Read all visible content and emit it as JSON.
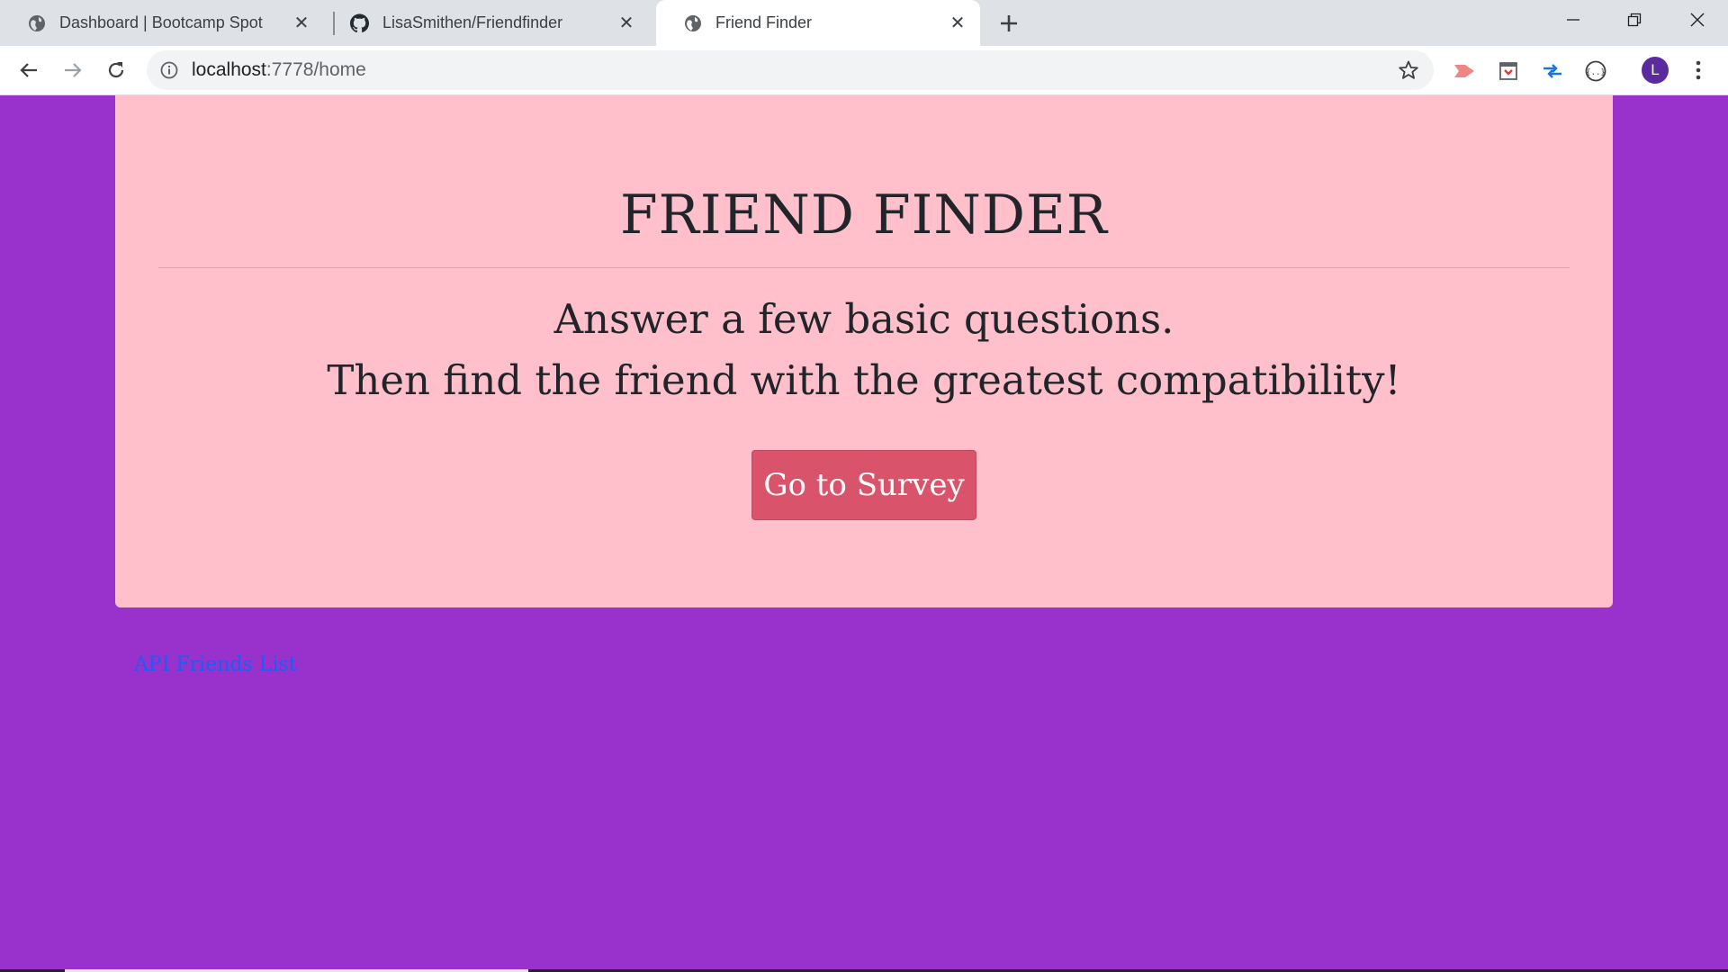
{
  "browser": {
    "tabs": [
      {
        "title": "Dashboard | Bootcamp Spot",
        "icon": "globe-icon",
        "active": false
      },
      {
        "title": "LisaSmithen/Friendfinder",
        "icon": "github-icon",
        "active": false
      },
      {
        "title": "Friend Finder",
        "icon": "globe-icon",
        "active": true
      }
    ],
    "url_host": "localhost",
    "url_rest": ":7778/home",
    "profile_initial": "L"
  },
  "page": {
    "title": "FRIEND FINDER",
    "subtitle_line1": "Answer a few basic questions.",
    "subtitle_line2": "Then find the friend with the greatest compatibility!",
    "survey_button": "Go to Survey",
    "api_link": "API Friends List"
  },
  "colors": {
    "page_background": "#9932CC",
    "jumbotron_background": "#FFC0CB",
    "button_background": "#D9536A",
    "link": "#1A5DF5"
  }
}
